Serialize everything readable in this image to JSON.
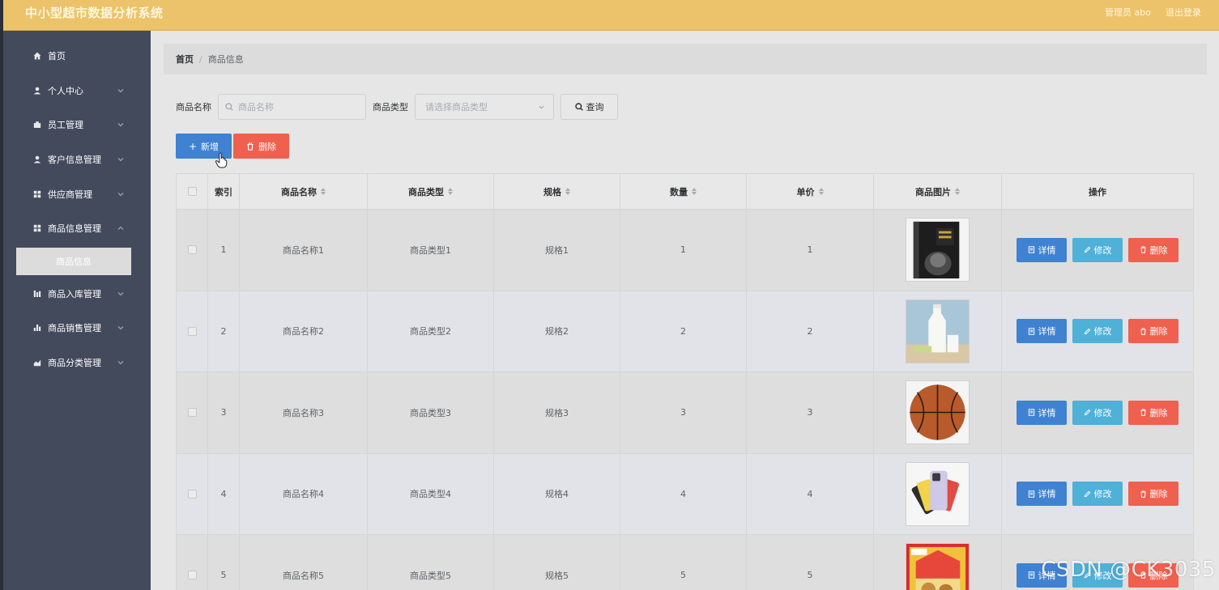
{
  "header": {
    "title": "中小型超市数据分析系统",
    "user_label": "管理员 abo",
    "logout_label": "退出登录"
  },
  "sidebar": {
    "items": [
      {
        "label": "首页",
        "icon": "home-icon"
      },
      {
        "label": "个人中心",
        "icon": "user-icon"
      },
      {
        "label": "员工管理",
        "icon": "briefcase-icon"
      },
      {
        "label": "客户信息管理",
        "icon": "user-icon"
      },
      {
        "label": "供应商管理",
        "icon": "grid-icon"
      },
      {
        "label": "商品信息管理",
        "icon": "grid-icon"
      },
      {
        "label": "商品入库管理",
        "icon": "bar-chart-icon"
      },
      {
        "label": "商品销售管理",
        "icon": "bar-chart-icon"
      },
      {
        "label": "商品分类管理",
        "icon": "area-chart-icon"
      }
    ],
    "active_sub": "商品信息"
  },
  "breadcrumb": {
    "home": "首页",
    "separator": "/",
    "current": "商品信息"
  },
  "search": {
    "name_label": "商品名称",
    "name_placeholder": "商品名称",
    "type_label": "商品类型",
    "type_placeholder": "请选择商品类型",
    "query_label": "查询"
  },
  "actions": {
    "add_label": "新增",
    "delete_label": "删除"
  },
  "table": {
    "columns": [
      "索引",
      "商品名称",
      "商品类型",
      "规格",
      "数量",
      "单价",
      "商品图片",
      "操作"
    ],
    "rows": [
      {
        "index": "1",
        "name": "商品名称1",
        "type": "商品类型1",
        "spec": "规格1",
        "qty": "1",
        "price": "1",
        "image": "book-cover"
      },
      {
        "index": "2",
        "name": "商品名称2",
        "type": "商品类型2",
        "spec": "规格2",
        "qty": "2",
        "price": "2",
        "image": "milk"
      },
      {
        "index": "3",
        "name": "商品名称3",
        "type": "商品类型3",
        "spec": "规格3",
        "qty": "3",
        "price": "3",
        "image": "basketball"
      },
      {
        "index": "4",
        "name": "商品名称4",
        "type": "商品类型4",
        "spec": "规格4",
        "qty": "4",
        "price": "4",
        "image": "phones"
      },
      {
        "index": "5",
        "name": "商品名称5",
        "type": "商品类型5",
        "spec": "规格5",
        "qty": "5",
        "price": "5",
        "image": "snack-box"
      }
    ],
    "row_actions": {
      "detail": "详情",
      "edit": "修改",
      "delete": "删除"
    }
  },
  "watermark": "CSDN @CK3035",
  "colors": {
    "header_bg": "#ecc36a",
    "sidebar_bg": "#434a5c",
    "primary": "#3f82d1",
    "info": "#4fb0d8",
    "danger": "#f0604f"
  }
}
